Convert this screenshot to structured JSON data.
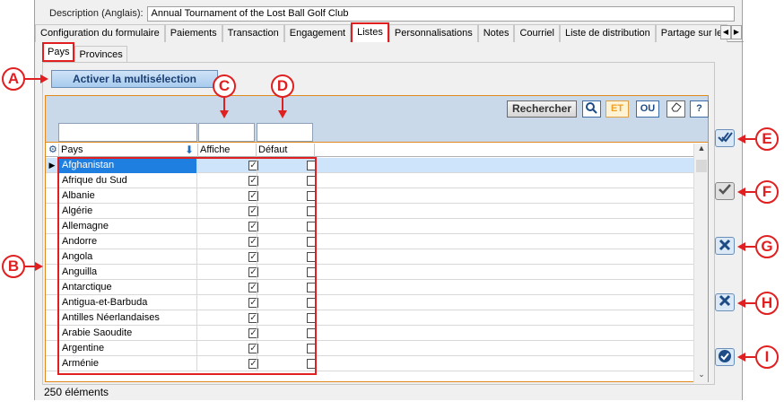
{
  "description": {
    "label": "Description (Anglais):",
    "value": "Annual Tournament of the Lost Ball Golf Club"
  },
  "tabs": [
    {
      "label": "Configuration du formulaire"
    },
    {
      "label": "Paiements"
    },
    {
      "label": "Transaction"
    },
    {
      "label": "Engagement"
    },
    {
      "label": "Listes",
      "active": true
    },
    {
      "label": "Personnalisations"
    },
    {
      "label": "Notes"
    },
    {
      "label": "Courriel"
    },
    {
      "label": "Liste de distribution"
    },
    {
      "label": "Partage sur le"
    }
  ],
  "subtabs": [
    {
      "label": "Pays",
      "active": true
    },
    {
      "label": "Provinces"
    }
  ],
  "multi_select_label": "Activer la multisélection",
  "toolbar": {
    "search_label": "Rechercher",
    "et_label": "ET",
    "ou_label": "OU",
    "help_label": "?"
  },
  "columns": {
    "pays": "Pays",
    "affiche": "Affiche",
    "defaut": "Défaut"
  },
  "rows": [
    {
      "pays": "Afghanistan",
      "affiche": true,
      "defaut": false,
      "selected": true
    },
    {
      "pays": "Afrique du Sud",
      "affiche": true,
      "defaut": false
    },
    {
      "pays": "Albanie",
      "affiche": true,
      "defaut": false
    },
    {
      "pays": "Algérie",
      "affiche": true,
      "defaut": false
    },
    {
      "pays": "Allemagne",
      "affiche": true,
      "defaut": false
    },
    {
      "pays": "Andorre",
      "affiche": true,
      "defaut": false
    },
    {
      "pays": "Angola",
      "affiche": true,
      "defaut": false
    },
    {
      "pays": "Anguilla",
      "affiche": true,
      "defaut": false
    },
    {
      "pays": "Antarctique",
      "affiche": true,
      "defaut": false
    },
    {
      "pays": "Antigua-et-Barbuda",
      "affiche": true,
      "defaut": false
    },
    {
      "pays": "Antilles Néerlandaises",
      "affiche": true,
      "defaut": false
    },
    {
      "pays": "Arabie Saoudite",
      "affiche": true,
      "defaut": false
    },
    {
      "pays": "Argentine",
      "affiche": true,
      "defaut": false
    },
    {
      "pays": "Arménie",
      "affiche": true,
      "defaut": false
    }
  ],
  "count_label": "250 éléments",
  "callouts": {
    "A": "A",
    "B": "B",
    "C": "C",
    "D": "D",
    "E": "E",
    "F": "F",
    "G": "G",
    "H": "H",
    "I": "I"
  },
  "icons": {
    "side_buttons": [
      "double-check-icon",
      "check-icon",
      "edit-tools-icon",
      "close-icon",
      "ok-circle-icon"
    ],
    "sort": "sort-down-arrow-icon",
    "settings": "settings-gear-icon"
  },
  "colors": {
    "accent_red": "#e02020",
    "selection_blue": "#1f7fe0",
    "filter_bar": "#c9d9ea"
  }
}
